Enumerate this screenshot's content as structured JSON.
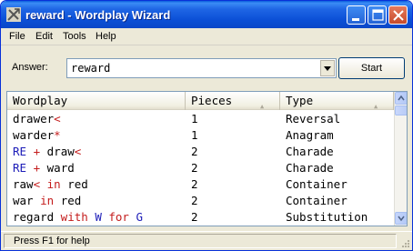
{
  "window": {
    "title": "reward - Wordplay Wizard",
    "icon": "wizard-tools-icon"
  },
  "title_buttons": [
    "minimize",
    "maximize",
    "close"
  ],
  "menu": [
    "File",
    "Edit",
    "Tools",
    "Help"
  ],
  "answer": {
    "label": "Answer:",
    "value": "reward"
  },
  "start_label": "Start",
  "columns": [
    "Wordplay",
    "Pieces",
    "Type"
  ],
  "rows": [
    {
      "wordplay": [
        {
          "t": "drawer",
          "c": "black"
        },
        {
          "t": "<",
          "c": "red"
        }
      ],
      "pieces": "1",
      "type": "Reversal"
    },
    {
      "wordplay": [
        {
          "t": "warder",
          "c": "black"
        },
        {
          "t": "*",
          "c": "red"
        }
      ],
      "pieces": "1",
      "type": "Anagram"
    },
    {
      "wordplay": [
        {
          "t": "RE",
          "c": "blue"
        },
        {
          "t": " + ",
          "c": "red"
        },
        {
          "t": "draw",
          "c": "black"
        },
        {
          "t": "<",
          "c": "red"
        }
      ],
      "pieces": "2",
      "type": "Charade"
    },
    {
      "wordplay": [
        {
          "t": "RE",
          "c": "blue"
        },
        {
          "t": " + ",
          "c": "red"
        },
        {
          "t": "ward",
          "c": "black"
        }
      ],
      "pieces": "2",
      "type": "Charade"
    },
    {
      "wordplay": [
        {
          "t": "raw",
          "c": "black"
        },
        {
          "t": "<",
          "c": "red"
        },
        {
          "t": " in ",
          "c": "red"
        },
        {
          "t": "red",
          "c": "black"
        }
      ],
      "pieces": "2",
      "type": "Container"
    },
    {
      "wordplay": [
        {
          "t": "war",
          "c": "black"
        },
        {
          "t": " in ",
          "c": "red"
        },
        {
          "t": "red",
          "c": "black"
        }
      ],
      "pieces": "2",
      "type": "Container"
    },
    {
      "wordplay": [
        {
          "t": "regard",
          "c": "black"
        },
        {
          "t": " with ",
          "c": "red"
        },
        {
          "t": "W",
          "c": "blue"
        },
        {
          "t": " for ",
          "c": "red"
        },
        {
          "t": "G",
          "c": "blue"
        }
      ],
      "pieces": "2",
      "type": "Substitution"
    }
  ],
  "status": "Press F1 for help",
  "colors": {
    "titlebar": "#0b4fd6",
    "token_red": "#c41c1c",
    "token_blue": "#1c1cb8"
  }
}
